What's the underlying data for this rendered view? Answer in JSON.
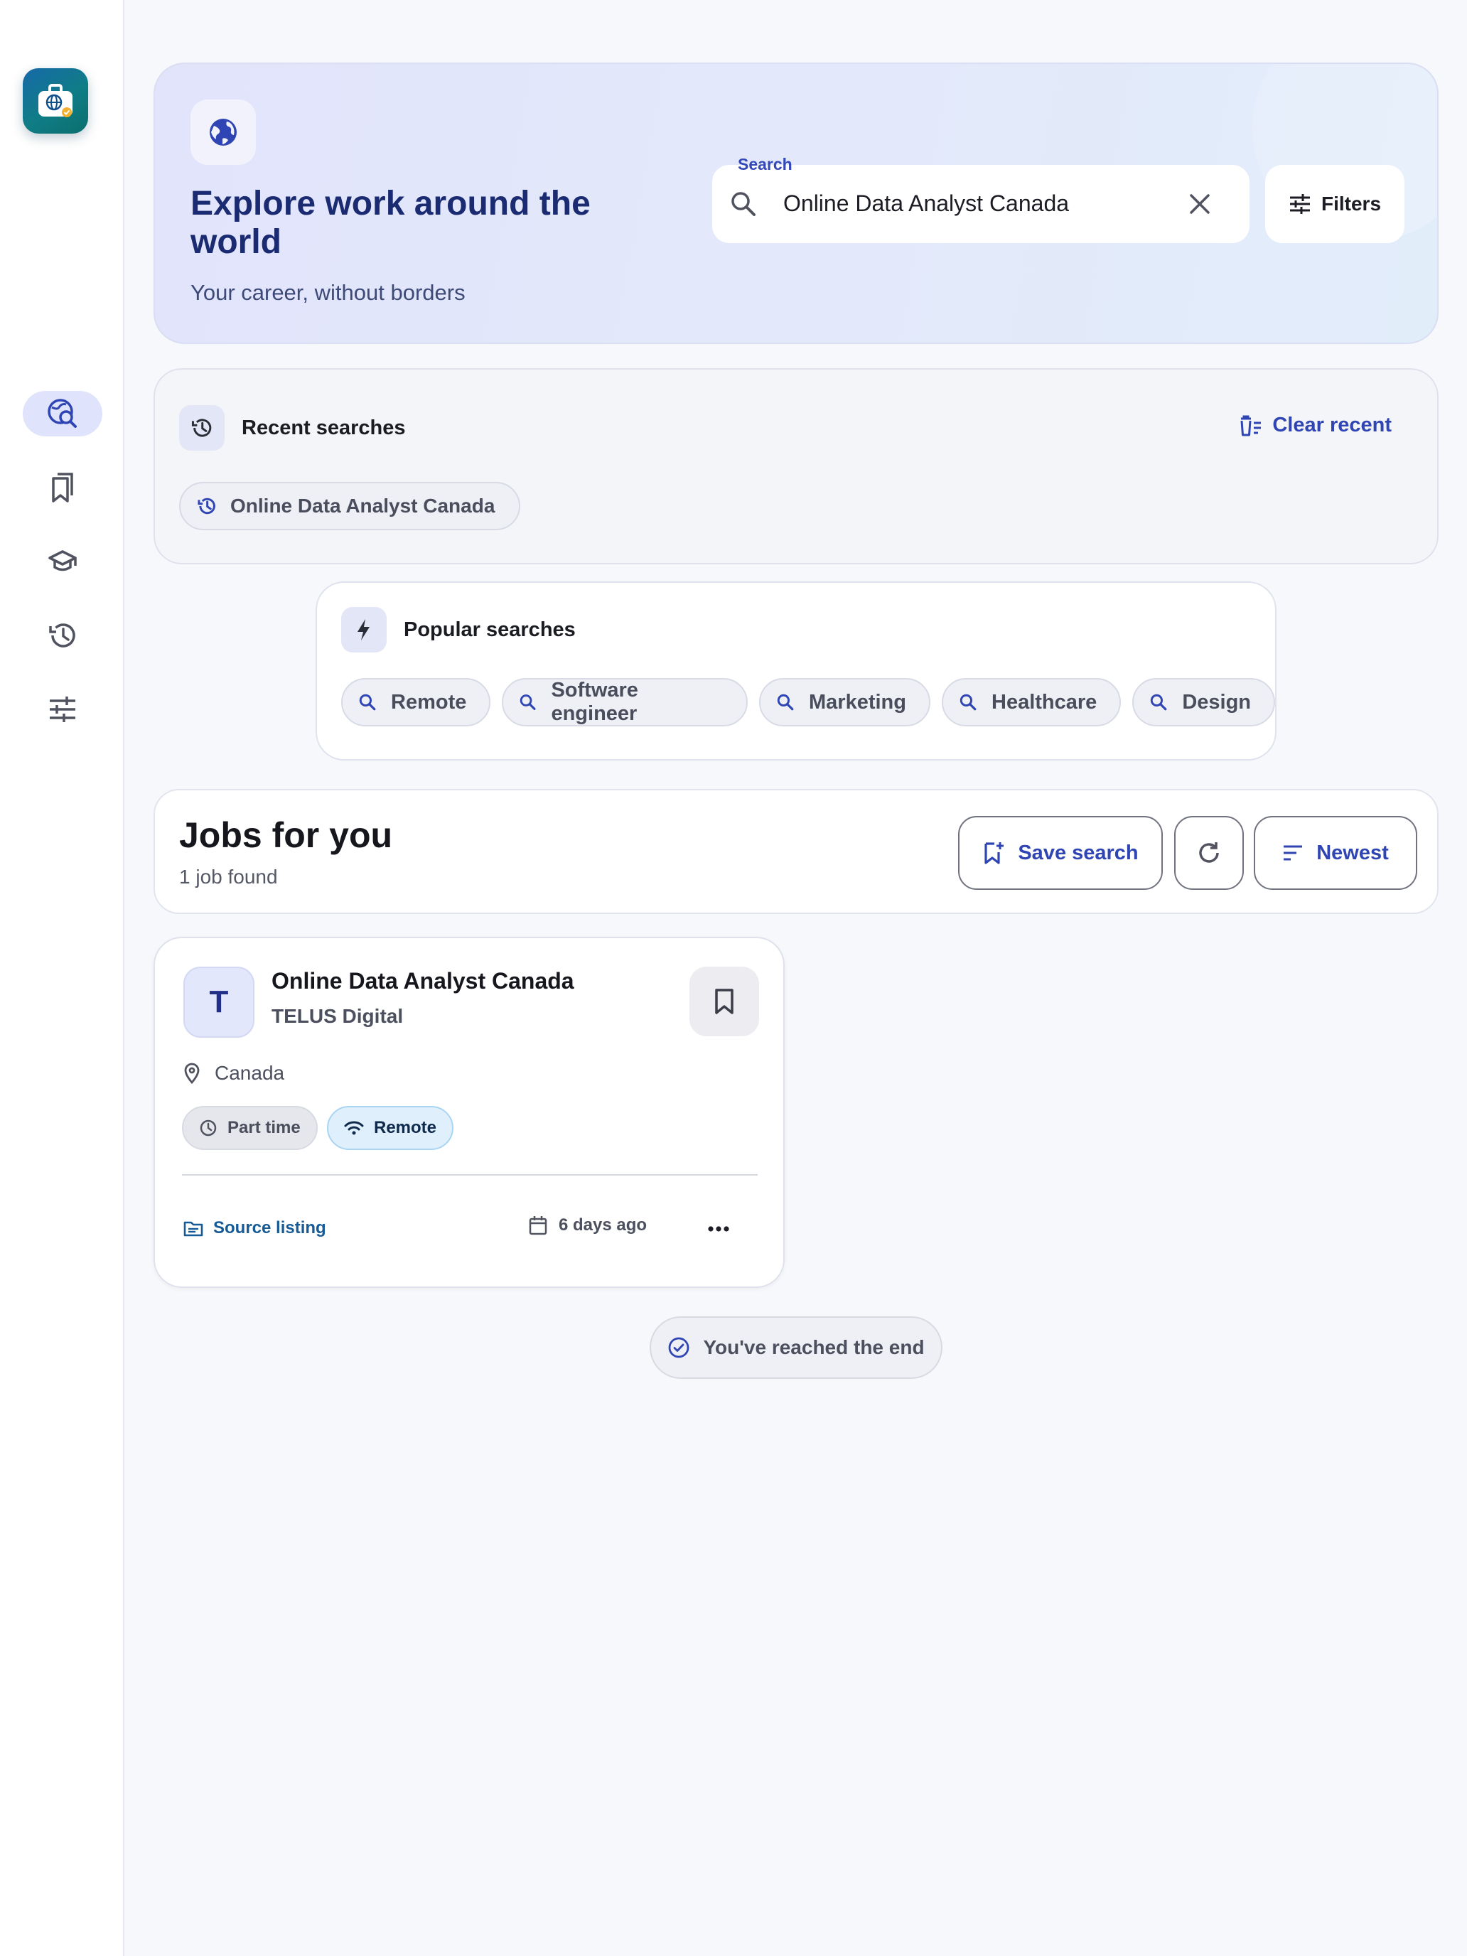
{
  "colors": {
    "accent": "#2f45b4",
    "hero_title": "#1a2b72",
    "sidebar_active_bg": "#dfe3fb",
    "remote_tag_bg": "#dff0fc",
    "source_link": "#175b96",
    "logo_gradient": [
      "#1769a8",
      "#0b6e6e"
    ]
  },
  "sidebar": {
    "logo_icon": "briefcase-globe-icon",
    "items": [
      {
        "icon": "globe-search-icon",
        "active": true
      },
      {
        "icon": "bookmarks-icon",
        "active": false
      },
      {
        "icon": "graduation-cap-icon",
        "active": false
      },
      {
        "icon": "history-icon",
        "active": false
      },
      {
        "icon": "tune-sliders-icon",
        "active": false
      }
    ]
  },
  "hero": {
    "icon": "globe-icon",
    "title": "Explore work around the world",
    "subtitle": "Your career, without borders",
    "search": {
      "label": "Search",
      "value": "Online Data Analyst Canada"
    },
    "filters_label": "Filters"
  },
  "recent": {
    "title": "Recent searches",
    "clear_label": "Clear recent",
    "items": [
      "Online Data Analyst Canada"
    ]
  },
  "popular": {
    "title": "Popular searches",
    "items": [
      "Remote",
      "Software engineer",
      "Marketing",
      "Healthcare",
      "Design"
    ]
  },
  "jobs": {
    "title": "Jobs for you",
    "count": "1 job found",
    "save_search_label": "Save search",
    "sort_label": "Newest",
    "items": [
      {
        "avatar_letter": "T",
        "title": "Online Data Analyst Canada",
        "company": "TELUS Digital",
        "location": "Canada",
        "tags": [
          "Part time",
          "Remote"
        ],
        "source_label": "Source listing",
        "posted": "6 days ago"
      }
    ]
  },
  "end_message": "You've reached the end"
}
